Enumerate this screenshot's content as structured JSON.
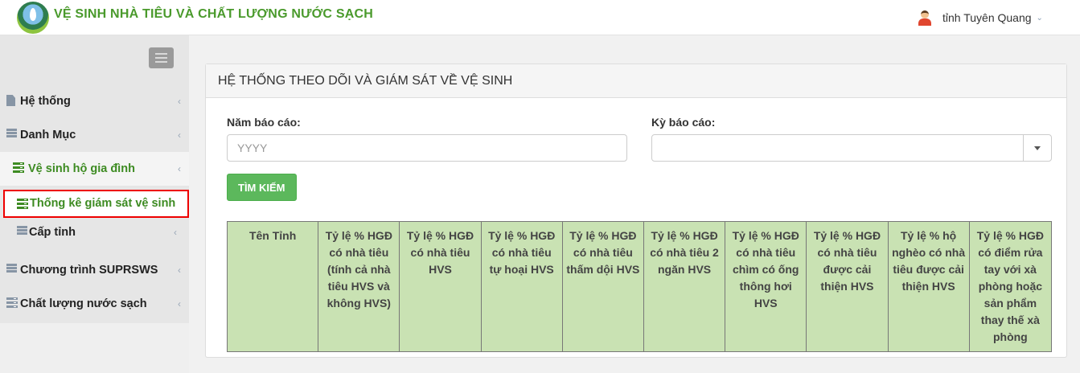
{
  "app": {
    "title": "VỆ SINH NHÀ TIÊU VÀ CHẤT LƯỢNG NƯỚC SẠCH",
    "logo_icon": "logo-icon"
  },
  "user": {
    "name": "tỉnh Tuyên Quang",
    "caret": "⌄"
  },
  "sidebar": {
    "items": [
      {
        "label": "Hệ thống",
        "icon": "file-icon",
        "caret": "‹"
      },
      {
        "label": "Danh Mục",
        "icon": "list-icon",
        "caret": "‹"
      },
      {
        "label": "Vệ sinh hộ gia đình",
        "icon": "stack-icon",
        "caret": "‹"
      },
      {
        "label": "Thống kê giám sát vệ sinh",
        "icon": "stack-icon"
      },
      {
        "label": "Cấp tỉnh",
        "icon": "list-icon",
        "caret": "‹"
      },
      {
        "label": "Chương trình SUPRSWS",
        "icon": "list-icon",
        "caret": "‹"
      },
      {
        "label": "Chất lượng nước sạch",
        "icon": "stack-icon",
        "caret": "‹"
      }
    ]
  },
  "panel": {
    "title": "HỆ THỐNG THEO DÕI VÀ GIÁM SÁT VỀ VỆ SINH",
    "year_label": "Năm báo cáo:",
    "year_placeholder": "YYYY",
    "period_label": "Kỳ báo cáo:",
    "period_value": "",
    "search_button": "TÌM KIẾM"
  },
  "table": {
    "headers": [
      "Tên Tỉnh",
      "Tỷ lệ % HGĐ có nhà tiêu (tính cả nhà tiêu HVS và không HVS)",
      "Tỷ lệ % HGĐ có nhà tiêu HVS",
      "Tỷ lệ % HGĐ có nhà tiêu tự hoại HVS",
      "Tỷ lệ % HGĐ có nhà tiêu thấm dội HVS",
      "Tỷ lệ % HGĐ có nhà tiêu 2 ngăn HVS",
      "Tỷ lệ % HGĐ có nhà tiêu chìm có ống thông hơi HVS",
      "Tỷ lệ % HGĐ có nhà tiêu được cải thiện HVS",
      "Tỷ lệ % hộ nghèo có nhà tiêu được cải thiện HVS",
      "Tỷ lệ % HGĐ có điểm rửa tay với xà phòng hoặc sản phẩm thay thế xà phòng"
    ]
  },
  "colors": {
    "brand_green": "#4a9a2c",
    "menu_active_green": "#3d8b22",
    "button_green": "#5cb85c",
    "table_header_bg": "#c9e2b3",
    "highlight_border": "#e00000"
  }
}
